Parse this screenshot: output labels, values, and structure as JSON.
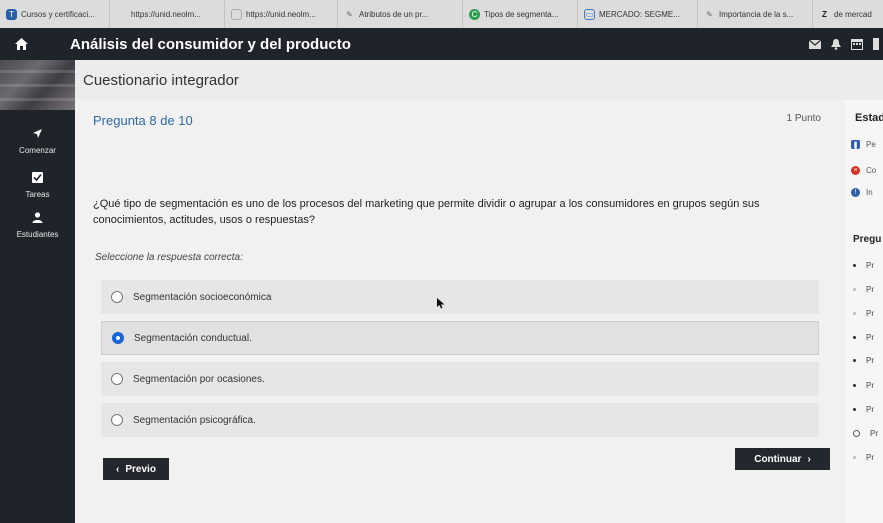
{
  "browser": {
    "tabs": [
      {
        "label": "Cursos y certificaci...",
        "icon": "t-logo-icon",
        "icon_color": "#2c5ea8",
        "icon_text": "T"
      },
      {
        "label": "https://unid.neolm...",
        "icon": "blank-page-icon",
        "icon_color": "#bbbbbb",
        "icon_text": ""
      },
      {
        "label": "https://unid.neolm...",
        "icon": "blank-page-icon",
        "icon_color": "#bbbbbb",
        "icon_text": ""
      },
      {
        "label": "Atributos de un pr...",
        "icon": "feather-icon",
        "icon_color": "#8a8a8a",
        "icon_text": ""
      },
      {
        "label": "Tipos de segmenta...",
        "icon": "green-circle-icon",
        "icon_color": "#2e9e4f",
        "icon_text": "C"
      },
      {
        "label": "MERCADO: SEGME...",
        "icon": "slides-icon",
        "icon_color": "#3a78c2",
        "icon_text": ""
      },
      {
        "label": "Importancia de la s...",
        "icon": "feather-icon",
        "icon_color": "#8a8a8a",
        "icon_text": ""
      },
      {
        "label": "de mercad",
        "icon": "z-logo-icon",
        "icon_color": "#222222",
        "icon_text": "Z"
      }
    ]
  },
  "header": {
    "title": "Análisis del consumidor y del producto"
  },
  "sidebar": {
    "items": [
      {
        "label": "Comenzar",
        "icon": "arrow-icon"
      },
      {
        "label": "Tareas",
        "icon": "checkbox-icon"
      },
      {
        "label": "Estudiantes",
        "icon": "user-icon"
      }
    ]
  },
  "main": {
    "subtitle": "Cuestionario integrador",
    "question_number": "Pregunta 8 de 10",
    "points": "1 Punto",
    "question_text": "¿Qué tipo de segmentación es uno de los procesos del marketing que permite dividir o agrupar a los consumidores en grupos según sus conocimientos, actitudes, usos o respuestas?",
    "instruction": "Seleccione la respuesta correcta:",
    "options": [
      {
        "label": "Segmentación socioeconómica",
        "selected": false
      },
      {
        "label": "Segmentación conductual.",
        "selected": true
      },
      {
        "label": "Segmentación por ocasiones.",
        "selected": false
      },
      {
        "label": "Segmentación psicográfica.",
        "selected": false
      }
    ],
    "prev_label": "Previo",
    "next_label": "Continuar"
  },
  "right_panel": {
    "status_heading": "Estad",
    "status_items": [
      {
        "label": "Pe",
        "icon": "pause-icon",
        "color": "#2c5ea8"
      },
      {
        "label": "Co",
        "icon": "x-circle-icon",
        "color": "#d93025"
      },
      {
        "label": "In",
        "icon": "info-circle-icon",
        "color": "#2c5ea8"
      }
    ],
    "questions_heading": "Pregu",
    "question_items": [
      {
        "label": "Pr",
        "state": "answered"
      },
      {
        "label": "Pr",
        "state": "unanswered"
      },
      {
        "label": "Pr",
        "state": "unanswered"
      },
      {
        "label": "Pr",
        "state": "answered"
      },
      {
        "label": "Pr",
        "state": "answered"
      },
      {
        "label": "Pr",
        "state": "answered"
      },
      {
        "label": "Pr",
        "state": "answered"
      },
      {
        "label": "Pr",
        "state": "current"
      },
      {
        "label": "Pr",
        "state": "unanswered"
      }
    ]
  },
  "colors": {
    "dark_bar": "#1f232a",
    "accent_blue": "#2f6aa6",
    "radio_selected": "#1565d8"
  }
}
